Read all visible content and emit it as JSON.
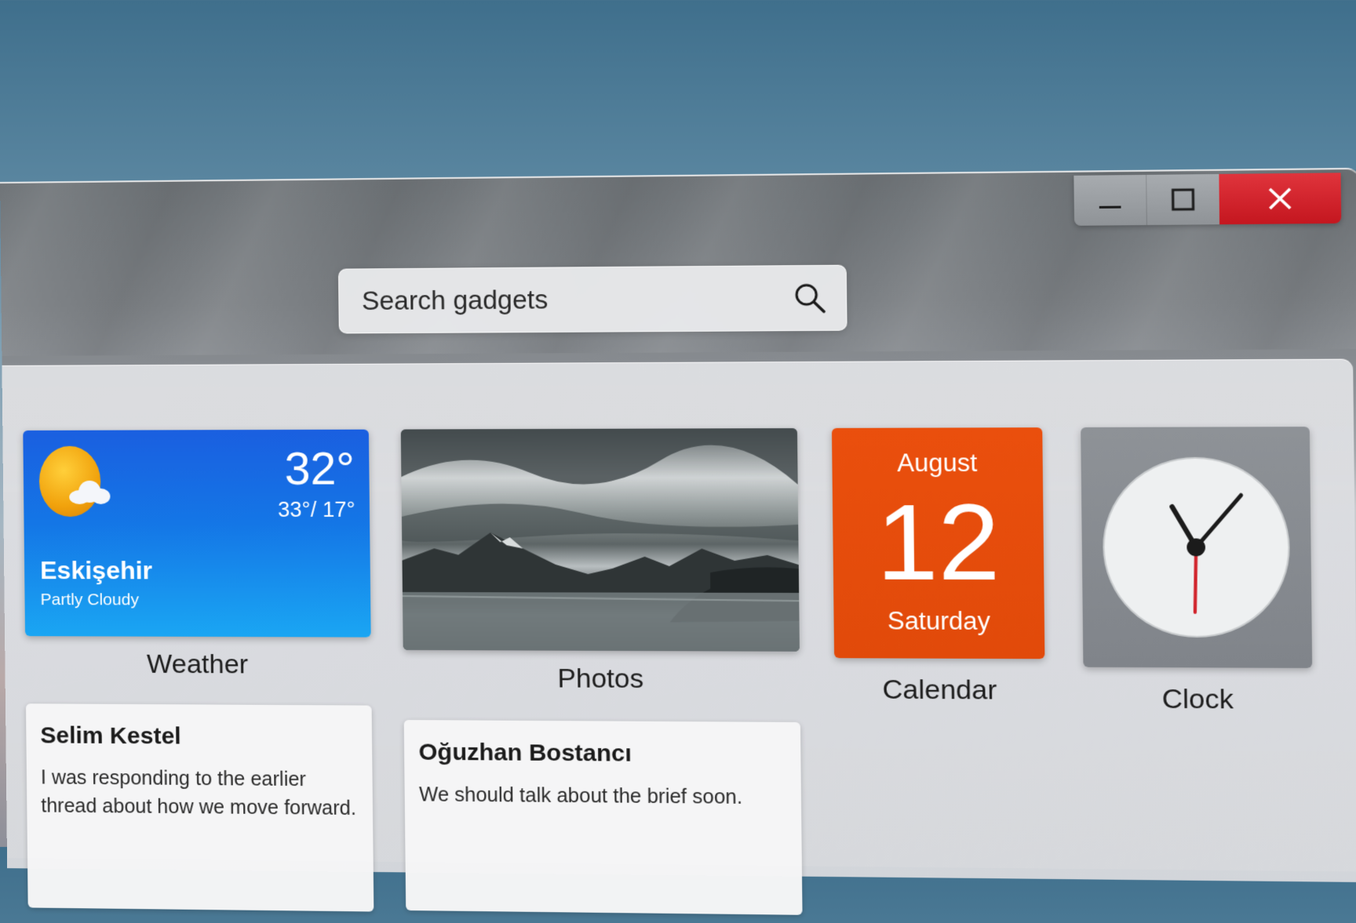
{
  "window": {
    "controls": {
      "minimize_icon": "minimize-icon",
      "maximize_icon": "maximize-icon",
      "close_icon": "close-icon"
    }
  },
  "search": {
    "placeholder": "Search gadgets",
    "icon": "search-icon"
  },
  "gadgets": {
    "weather": {
      "caption": "Weather",
      "temperature": "32°",
      "high_low": "33°/ 17°",
      "city": "Eskişehir",
      "condition": "Partly Cloudy",
      "icon": "partly-cloudy-icon"
    },
    "photos": {
      "caption": "Photos"
    },
    "calendar": {
      "caption": "Calendar",
      "month": "August",
      "day": "12",
      "weekday": "Saturday",
      "color": "#e84d0c"
    },
    "clock": {
      "caption": "Clock"
    }
  },
  "messages": [
    {
      "from": "Selim Kestel",
      "body": "I was responding to the earlier thread about how we move forward."
    },
    {
      "from": "Oğuzhan Bostancı",
      "body": "We should talk about the brief soon."
    }
  ],
  "colors": {
    "close_button": "#d1232b",
    "weather_top": "#1a5fe0",
    "weather_bottom": "#1aa6f3"
  }
}
